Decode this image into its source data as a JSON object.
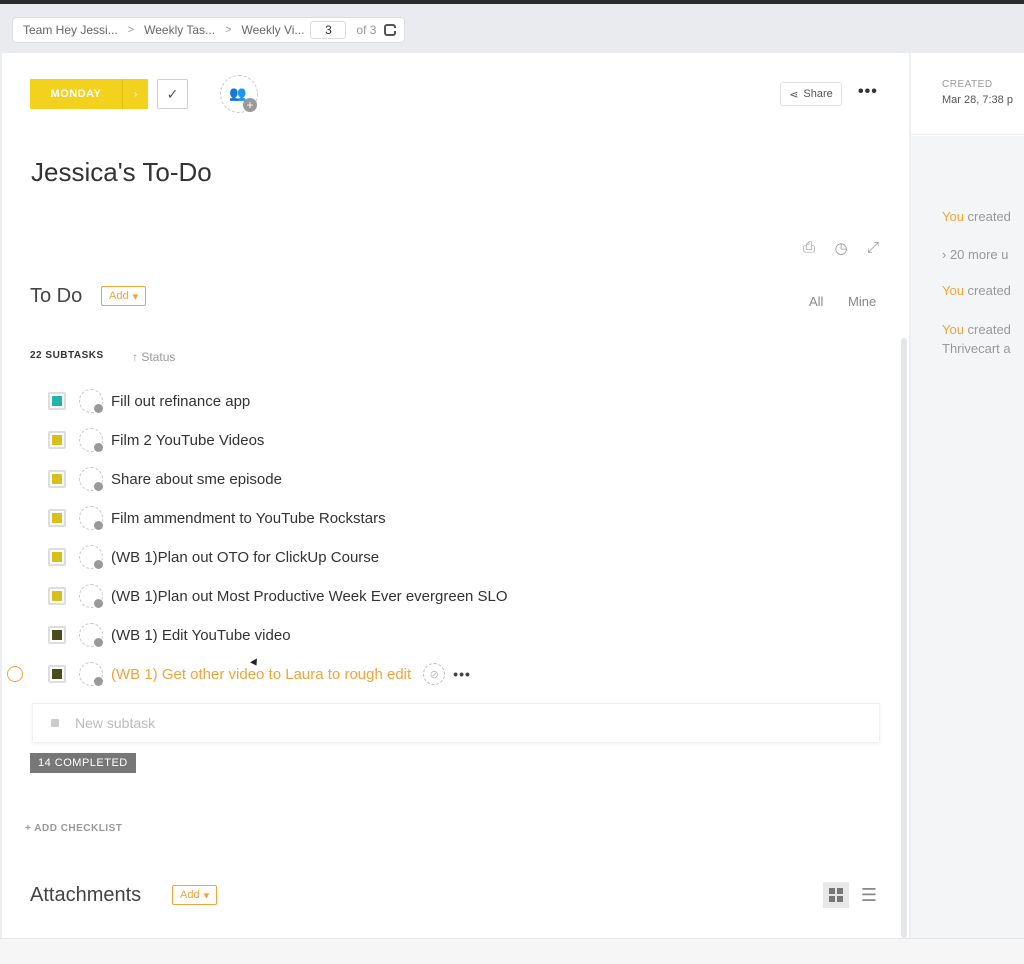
{
  "breadcrumb": {
    "items": [
      "Team Hey Jessi...",
      "Weekly Tas...",
      "Weekly Vi..."
    ],
    "page": "3",
    "of_label": "of 3"
  },
  "toolbar": {
    "status_label": "MONDAY",
    "status_color": "#f2d21c",
    "share_label": "Share"
  },
  "task": {
    "title": "Jessica's To-Do"
  },
  "section": {
    "title": "To Do",
    "add_label": "Add",
    "filters": [
      "All",
      "Mine"
    ]
  },
  "subtasks": {
    "header": "22 SUBTASKS",
    "sort_label": "Status",
    "items": [
      {
        "label": "Fill out refinance app",
        "color": "#1fb5a8"
      },
      {
        "label": "Film 2 YouTube Videos",
        "color": "#d8bf1a"
      },
      {
        "label": "Share about sme episode",
        "color": "#d8bf1a"
      },
      {
        "label": "Film ammendment to YouTube Rockstars",
        "color": "#d8bf1a"
      },
      {
        "label": "(WB 1)Plan out OTO for ClickUp Course",
        "color": "#d8bf1a"
      },
      {
        "label": "(WB 1)Plan out Most Productive Week Ever evergreen SLO",
        "color": "#d8bf1a"
      },
      {
        "label": "(WB 1) Edit YouTube video",
        "color": "#4a4d1a"
      },
      {
        "label": "(WB 1) Get other video to Laura to rough edit",
        "color": "#4a4d1a"
      }
    ],
    "new_placeholder": "New subtask",
    "completed_label": "14 COMPLETED"
  },
  "checklist": {
    "add_label": "+ ADD CHECKLIST"
  },
  "attachments": {
    "title": "Attachments",
    "add_label": "Add"
  },
  "sidebar": {
    "created_label": "CREATED",
    "created_date": "Mar 28, 7:38 p",
    "activity_1": {
      "you": "You",
      "text": " created"
    },
    "more_updates": "› 20 more u",
    "activity_2": {
      "you": "You",
      "text": " created"
    },
    "activity_3": {
      "you": "You",
      "text": " created"
    },
    "activity_3_line2": "Thrivecart a"
  }
}
